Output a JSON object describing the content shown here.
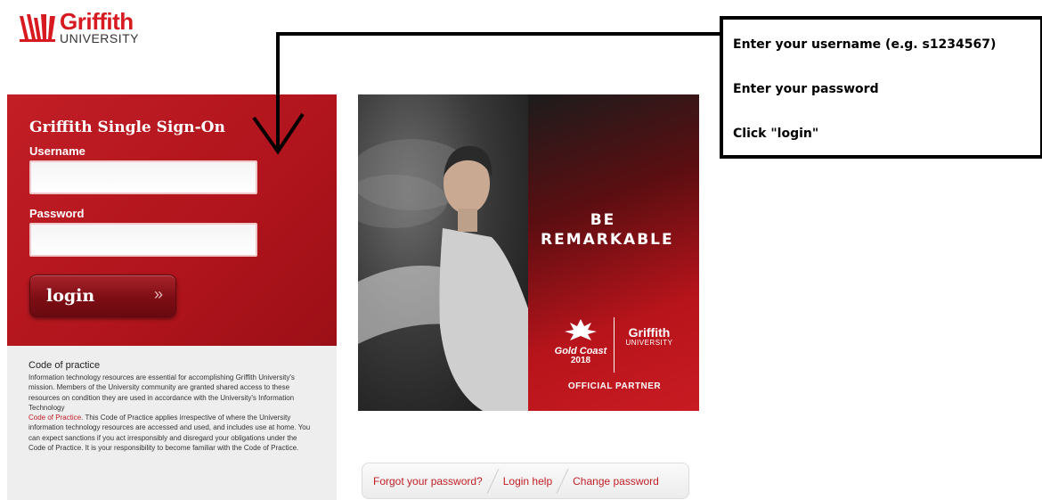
{
  "logo": {
    "wordmark": "Griffith",
    "subtext": "UNIVERSITY"
  },
  "login": {
    "title": "Griffith Single Sign-On",
    "username_label": "Username",
    "username_value": "",
    "password_label": "Password",
    "password_value": "",
    "button_label": "login",
    "button_arrow": "»"
  },
  "code_of_practice": {
    "title": "Code of practice",
    "text_1": "Information technology resources are essential for accomplishing Griffith University's mission. Members of the University community are granted shared access to these resources on condition they are used in accordance with the University's Information Technology",
    "link": "Code of Practice",
    "text_2": ". This Code of Practice applies irrespective of where the University information technology resources are accessed and used, and includes use at home. You can expect sanctions if you act irresponsibly and disregard your obligations under the Code of Practice. It is your responsibility to become familiar with the Code of Practice."
  },
  "promo": {
    "line_1": "BE",
    "line_2": "REMARKABLE",
    "gc_text": "Gold Coast",
    "gc_year": "2018",
    "griffith_word": "Griffith",
    "griffith_sub": "UNIVERSITY",
    "partner": "OFFICIAL PARTNER"
  },
  "links": {
    "forgot": "Forgot your password?",
    "help": "Login help",
    "change": "Change password"
  },
  "callout": {
    "line_1": "Enter your username (e.g. s1234567)",
    "line_2": "Enter your password",
    "line_3": "Click \"login\""
  },
  "colors": {
    "brand_red": "#c21e26",
    "panel_dark": "#9c0f16",
    "button_dark": "#6a0a10"
  },
  "icons": {
    "logo_mark": "griffith-flame-icon",
    "login_arrow": "double-chevron-right-icon",
    "games_mark": "gold-coast-games-icon"
  }
}
